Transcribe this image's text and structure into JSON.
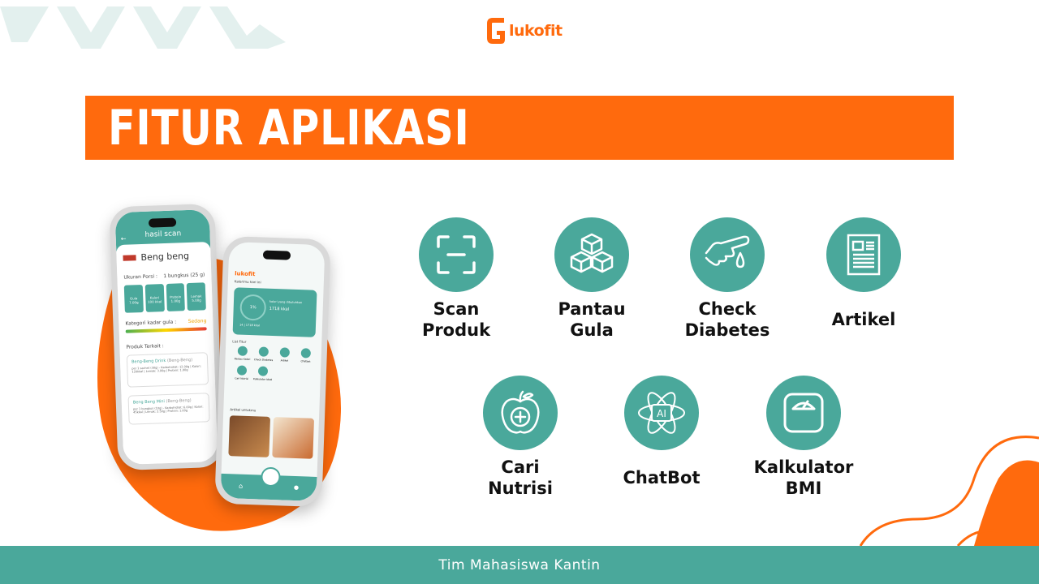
{
  "brand": {
    "logo_text": "lukofit"
  },
  "banner": {
    "title": "FITUR APLIKASI"
  },
  "features": [
    {
      "icon": "scan-icon",
      "line1": "Scan",
      "line2": "Produk"
    },
    {
      "icon": "cubes-icon",
      "line1": "Pantau",
      "line2": "Gula"
    },
    {
      "icon": "finger-drop-icon",
      "line1": "Check",
      "line2": "Diabetes"
    },
    {
      "icon": "newspaper-icon",
      "line1": "Artikel",
      "line2": ""
    },
    {
      "icon": "apple-icon",
      "line1": "Cari",
      "line2": "Nutrisi"
    },
    {
      "icon": "ai-atom-icon",
      "line1": "ChatBot",
      "line2": ""
    },
    {
      "icon": "scale-icon",
      "line1": "Kalkulator",
      "line2": "BMI"
    }
  ],
  "phone_left": {
    "header": "hasil scan",
    "product": "Beng beng",
    "portion_label": "Ukuran Porsi :",
    "portion_value": "1 bungkus (25 g)",
    "nutrients": [
      {
        "name": "Gula",
        "value": "7.00g"
      },
      {
        "name": "Kalori",
        "value": "100 kkal"
      },
      {
        "name": "Protein",
        "value": "1.00g"
      },
      {
        "name": "Lemak",
        "value": "5.00g"
      }
    ],
    "sugar_category_label": "Kategori kadar gula :",
    "sugar_category_value": "Sedang",
    "related_title": "Produk Terkait :",
    "related": [
      {
        "name": "Beng-Beng Drink",
        "brand": "(Beng-Beng)",
        "desc": "per 1 sachet (30g) - Karbohidrat: 12.00g | Kalori: 120kkal | Lemak: 3.00g | Protein: 1.00g"
      },
      {
        "name": "Beng Beng Mini",
        "brand": "(Beng-Beng)",
        "desc": "per 1 bungkus (10g) - Karbohidrat: 6.00g | Kalori: 45kkal | Lemak: 2.50g | Protein: 1.00g"
      }
    ]
  },
  "phone_right": {
    "calorie_title": "Kalorimu hari ini",
    "percent": "1%",
    "needed_label": "kalori yang dibutuhkan",
    "needed_value": "1718 kkal",
    "consumed": "14 | 1718 kkal",
    "fitur_title": "List Fitur",
    "fitur": [
      "Pantau Kalori",
      "Check Diabetes",
      "Artikel",
      "Chatbot",
      "Cari Nutrisi",
      "Kalkulator Ideal"
    ],
    "article_title": "Artikel untukmu"
  },
  "footer": {
    "text": "Tim Mahasiswa Kantin"
  },
  "colors": {
    "orange": "#ff6a0d",
    "teal": "#4aa89b",
    "deco": "#e3f0ee"
  }
}
